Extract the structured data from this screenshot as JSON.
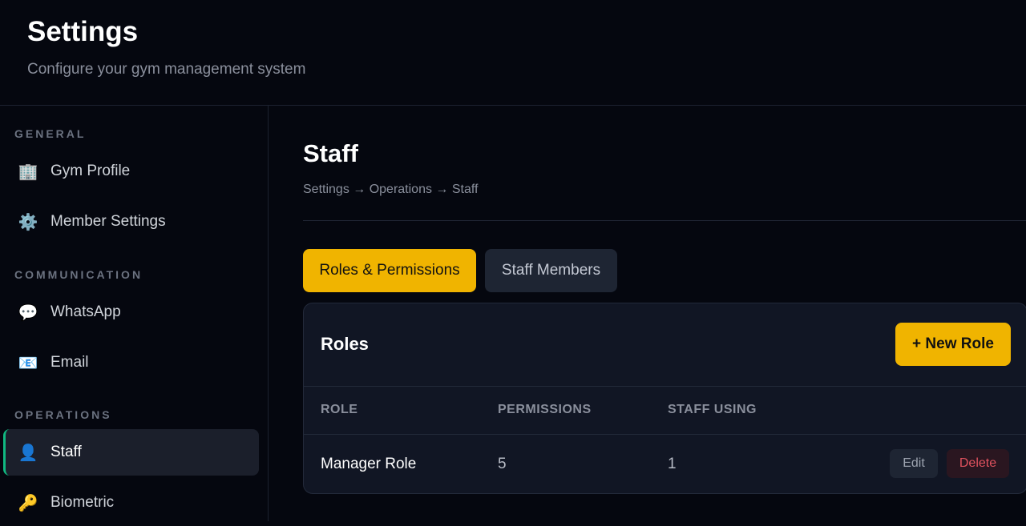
{
  "header": {
    "title": "Settings",
    "subtitle": "Configure your gym management system"
  },
  "sidebar": {
    "sections": [
      {
        "label": "GENERAL",
        "items": [
          {
            "label": "Gym Profile",
            "icon": "🏢",
            "icon_name": "building-icon"
          },
          {
            "label": "Member Settings",
            "icon": "⚙️",
            "icon_name": "gear-icon"
          }
        ]
      },
      {
        "label": "COMMUNICATION",
        "items": [
          {
            "label": "WhatsApp",
            "icon": "💬",
            "icon_name": "speech-bubble-icon"
          },
          {
            "label": "Email",
            "icon": "📧",
            "icon_name": "email-icon"
          }
        ]
      },
      {
        "label": "OPERATIONS",
        "items": [
          {
            "label": "Staff",
            "icon": "👤",
            "icon_name": "person-icon",
            "active": true
          },
          {
            "label": "Biometric",
            "icon": "🔑",
            "icon_name": "key-icon"
          }
        ]
      }
    ]
  },
  "main": {
    "title": "Staff",
    "breadcrumb": "Settings → Operations → Staff",
    "tabs": [
      {
        "label": "Roles & Permissions",
        "active": true
      },
      {
        "label": "Staff Members",
        "active": false
      }
    ],
    "card": {
      "title": "Roles",
      "new_button": "+ New Role",
      "columns": [
        "ROLE",
        "PERMISSIONS",
        "STAFF USING"
      ],
      "rows": [
        {
          "role": "Manager Role",
          "permissions": "5",
          "staff_using": "1",
          "edit_label": "Edit",
          "delete_label": "Delete"
        }
      ]
    }
  },
  "colors": {
    "accent": "#f0b400",
    "active_indicator": "#10b981",
    "danger": "#e0525e",
    "background": "#05070f",
    "card": "#111624"
  }
}
